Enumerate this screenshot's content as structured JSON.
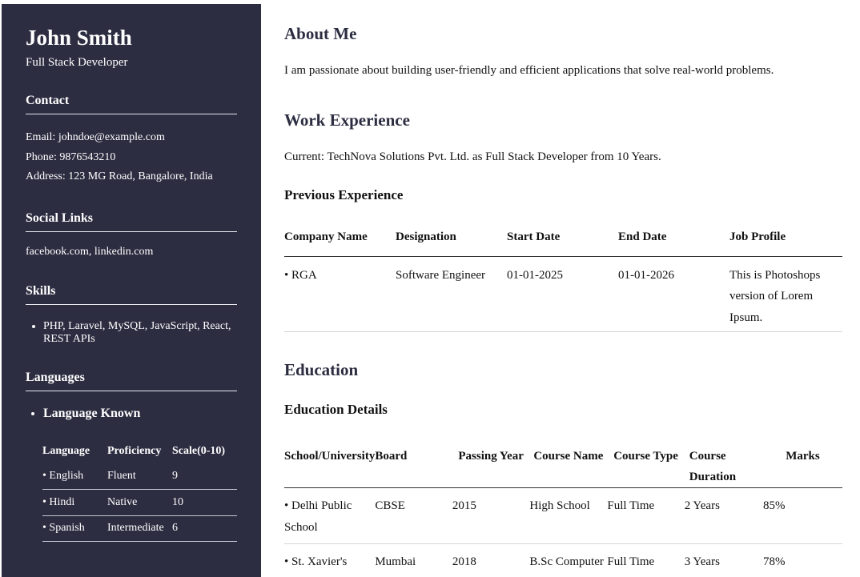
{
  "profile": {
    "name": "John Smith",
    "role": "Full Stack Developer"
  },
  "contact": {
    "heading": "Contact",
    "email": "Email: johndoe@example.com",
    "phone": "Phone: 9876543210",
    "address": "Address: 123 MG Road, Bangalore, India"
  },
  "social": {
    "heading": "Social Links",
    "links": "facebook.com, linkedin.com"
  },
  "skills": {
    "heading": "Skills",
    "items": [
      "PHP, Laravel, MySQL, JavaScript, React, REST APIs"
    ]
  },
  "languages": {
    "heading": "Languages",
    "known_label": "Language Known",
    "columns": [
      "Language",
      "Proficiency",
      "Scale(0-10)"
    ],
    "rows": [
      [
        "• English",
        "Fluent",
        "9"
      ],
      [
        "• Hindi",
        "Native",
        "10"
      ],
      [
        "• Spanish",
        "Intermediate",
        "6"
      ]
    ]
  },
  "about": {
    "heading": "About Me",
    "text": "I am passionate about building user-friendly and efficient applications that solve real-world problems."
  },
  "work": {
    "heading": "Work Experience",
    "current": "Current: TechNova Solutions Pvt. Ltd. as Full Stack Developer from 10 Years.",
    "previous_heading": "Previous Experience",
    "columns": [
      "Company Name",
      "Designation",
      "Start Date",
      "End Date",
      "Job Profile"
    ],
    "rows": [
      [
        "• RGA",
        "Software Engineer",
        "01-01-2025",
        "01-01-2026",
        "This is Photoshops version of Lorem Ipsum."
      ]
    ]
  },
  "education": {
    "heading": "Education",
    "details_heading": "Education Details",
    "columns": [
      "School/University",
      "Board",
      "Passing Year",
      "Course Name",
      "Course Type",
      "Course Duration",
      "Marks"
    ],
    "rows": [
      [
        "• Delhi Public School",
        "CBSE",
        "2015",
        "High School",
        "Full Time",
        "2 Years",
        "85%"
      ],
      [
        "• St. Xavier's",
        "Mumbai",
        "2018",
        "B.Sc Computer",
        "Full Time",
        "3 Years",
        "78%"
      ]
    ]
  }
}
